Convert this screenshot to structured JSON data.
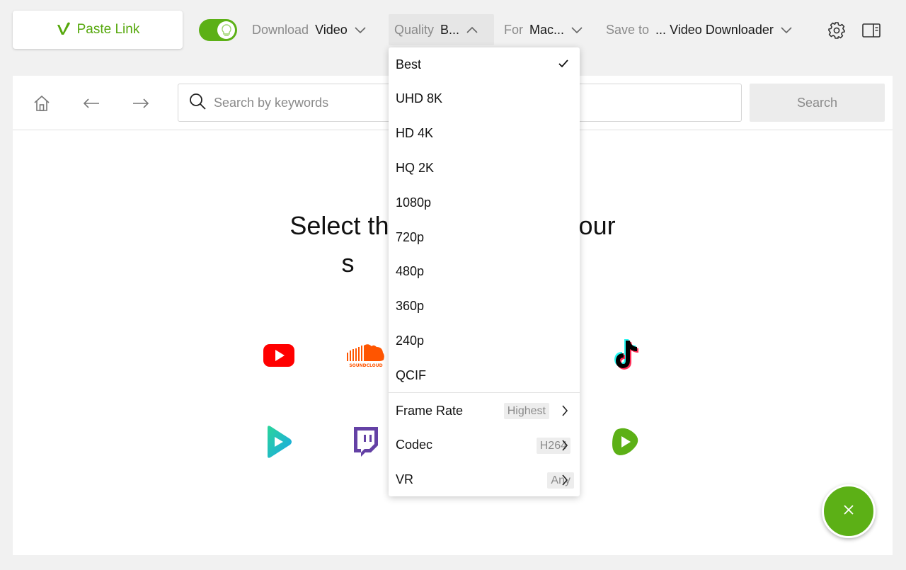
{
  "toolbar": {
    "paste_label": "Paste Link",
    "download": {
      "label": "Download",
      "value": "Video"
    },
    "quality": {
      "label": "Quality",
      "value": "B..."
    },
    "for": {
      "label": "For",
      "value": "Mac..."
    },
    "save_to": {
      "label": "Save to",
      "ellipsis": "...",
      "value": "Video Downloader"
    },
    "smart_mode_on": true
  },
  "browser": {
    "search_placeholder": "Search by keywords",
    "search_button": "Search",
    "headline_line1": "Select the serv        nter your",
    "headline_line2": "s"
  },
  "quality_menu": {
    "selected": "Best",
    "options": [
      "Best",
      "UHD 8K",
      "HD 4K",
      "HQ 2K",
      "1080p",
      "720p",
      "480p",
      "360p",
      "240p",
      "QCIF"
    ],
    "submenus": [
      {
        "label": "Frame Rate",
        "value": "Highest"
      },
      {
        "label": "Codec",
        "value": "H264"
      },
      {
        "label": "VR",
        "value": "Any"
      }
    ]
  },
  "services": [
    "youtube-icon",
    "soundcloud-icon",
    "tiktok-icon",
    "play-icon",
    "twitch-icon",
    "rumble-icon"
  ],
  "colors": {
    "accent": "#5cb016",
    "link": "#56a80c",
    "youtube": "#ff0000",
    "soundcloud": "#ff5500",
    "twitch": "#6441a5"
  }
}
